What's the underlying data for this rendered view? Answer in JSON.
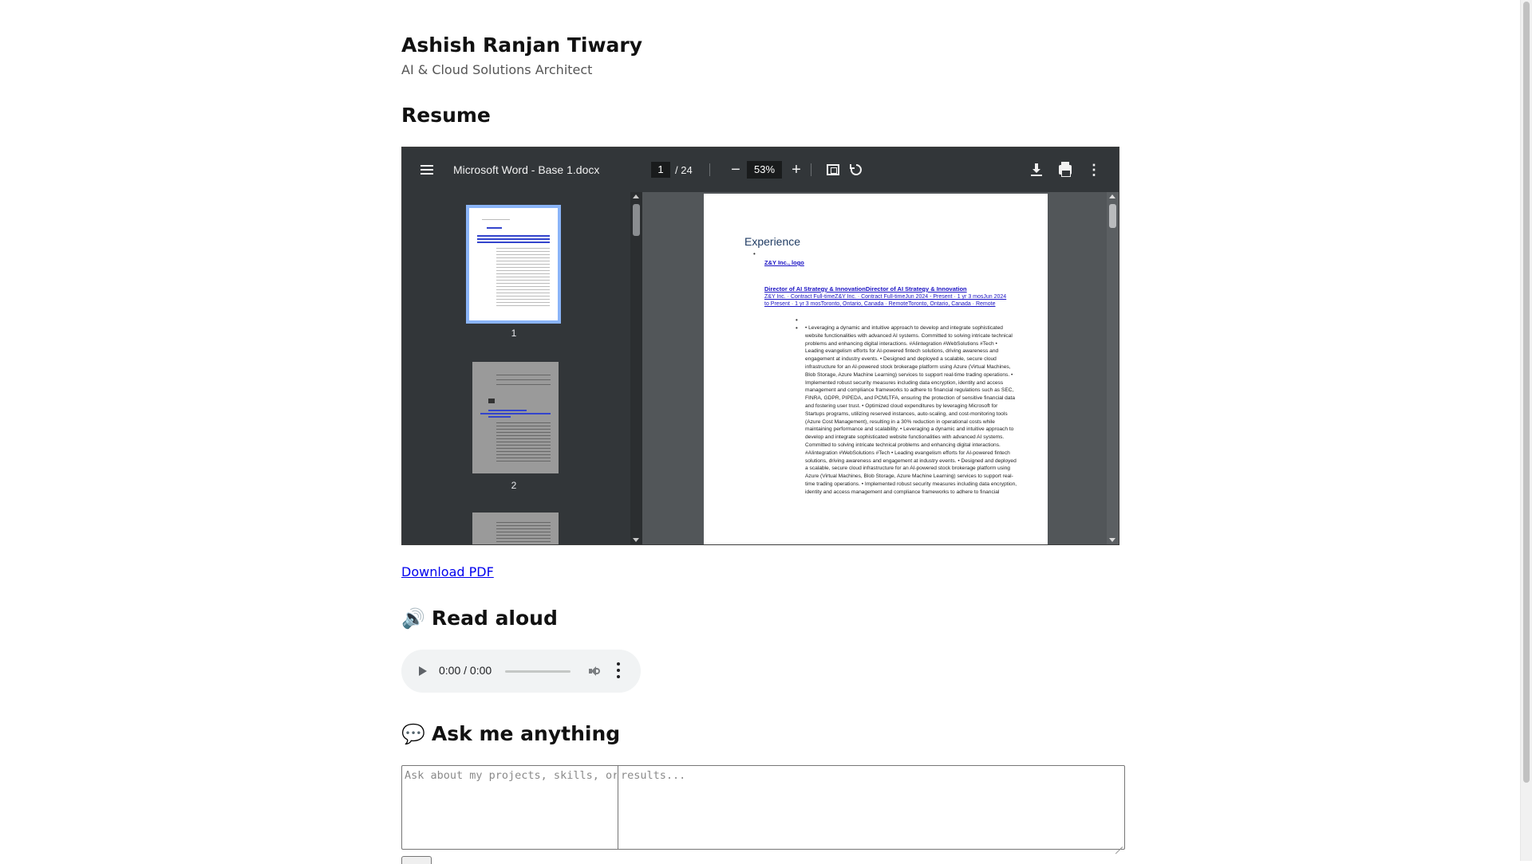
{
  "header": {
    "name": "Ashish Ranjan Tiwary",
    "subtitle": "AI & Cloud Solutions Architect"
  },
  "resume": {
    "heading": "Resume",
    "viewer": {
      "file_title": "Microsoft Word - Base 1.docx",
      "current_page": "1",
      "page_total": "/ 24",
      "zoom": "53%",
      "zoom_out_label": "−",
      "zoom_in_label": "+",
      "more_label": "⋮",
      "thumbnails": [
        {
          "label": "1",
          "selected": true
        },
        {
          "label": "2",
          "selected": false
        }
      ],
      "document": {
        "heading": "Experience",
        "bullet": "•",
        "company_link": "Z&Y Inc., logo",
        "role_link": "Director of AI Strategy & InnovationDirector of AI Strategy & Innovation",
        "meta_link": "Z&Y Inc. · Contract Full-timeZ&Y Inc. · Contract Full-timeJun 2024 - Present · 1 yr 3 mosJun 2024 to Present · 1 yr 3 mosToronto, Ontario, Canada · RemoteToronto, Ontario, Canada · Remote",
        "body": "• Leveraging a dynamic and intuitive approach to develop and integrate sophisticated website functionalities with advanced AI systems. Committed to solving intricate technical problems and enhancing digital interactions. #AIintegration #WebSolutions #Tech • Leading evangelism efforts for AI-powered fintech solutions, driving awareness and engagement at industry events. • Designed and deployed a scalable, secure cloud infrastructure for an AI-powered stock brokerage platform using Azure (Virtual Machines, Blob Storage, Azure Machine Learning) services to support real-time trading operations. • Implemented robust security measures including data encryption, identity and access management and compliance frameworks to adhere to financial regulations such as SEC, FINRA, GDPR, PIPEDA, and PCMLTFA, ensuring the protection of sensitive financial data and fostering user trust. • Optimized cloud expenditures by leveraging Microsoft for Startups programs, utilizing reserved instances, auto-scaling, and cost-monitoring tools (Azure Cost Management), resulting in a 30% reduction in operational costs while maintaining performance and scalability. • Leveraging a dynamic and intuitive approach to develop and integrate sophisticated website functionalities with advanced AI systems. Committed to solving intricate technical problems and enhancing digital interactions. #AIintegration #WebSolutions #Tech • Leading evangelism efforts for AI-powered fintech solutions, driving awareness and engagement at industry events. • Designed and deployed a scalable, secure cloud infrastructure for an AI-powered stock brokerage platform using Azure (Virtual Machines, Blob Storage, Azure Machine Learning) services to support real-time trading operations. • Implemented robust security measures including data encryption, identity and access management and compliance frameworks to adhere to financial"
      }
    },
    "download_label": "Download PDF"
  },
  "read_aloud": {
    "emoji": "🔊",
    "heading": "Read aloud",
    "time": "0:00 / 0:00"
  },
  "ask": {
    "emoji": "💬",
    "heading": "Ask me anything",
    "placeholder_left": "Ask about my projects, skills, or",
    "placeholder_right": "results..."
  },
  "colors": {
    "link": "#0000ee",
    "viewer_toolbar": "#323639",
    "viewer_background": "#525659",
    "thumbnail_selected": "#8ab4f8"
  }
}
